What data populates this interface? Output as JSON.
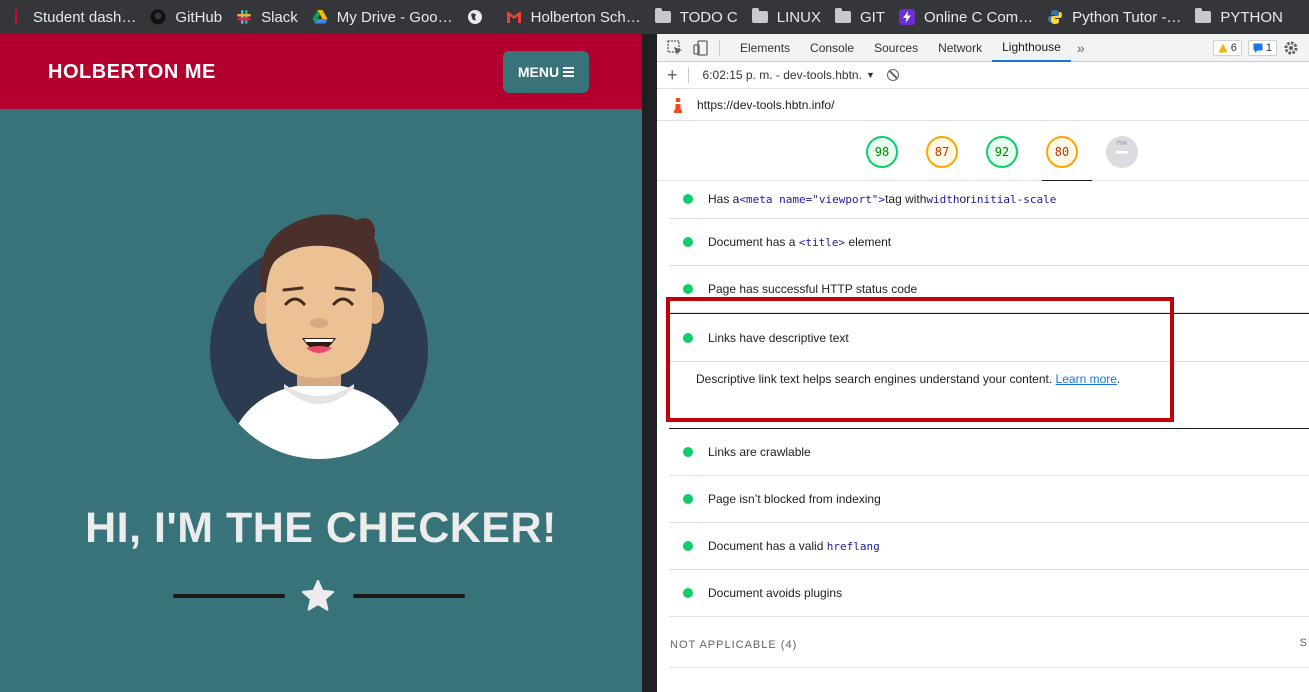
{
  "bookmarks": [
    {
      "label": "Student dash…",
      "icon": "holberton-icon"
    },
    {
      "label": "GitHub",
      "icon": "github-icon"
    },
    {
      "label": "Slack",
      "icon": "slack-icon"
    },
    {
      "label": "My Drive - Goo…",
      "icon": "drive-icon"
    },
    {
      "label": "",
      "icon": "globe-icon"
    },
    {
      "label": "Holberton Sch…",
      "icon": "gmail-icon"
    },
    {
      "label": "TODO C",
      "icon": "folder-icon"
    },
    {
      "label": "LINUX",
      "icon": "folder-icon"
    },
    {
      "label": "GIT",
      "icon": "folder-icon"
    },
    {
      "label": "Online C Com…",
      "icon": "bolt-icon"
    },
    {
      "label": "Python Tutor -…",
      "icon": "python-icon"
    },
    {
      "label": "PYTHON",
      "icon": "folder-icon"
    }
  ],
  "site": {
    "brand": "HOLBERTON ME",
    "menu_label": "MENU",
    "hero_title": "HI, I'M THE CHECKER!",
    "colors": {
      "header": "#b2002f",
      "body": "#377378"
    }
  },
  "devtools": {
    "tabs": [
      "Elements",
      "Console",
      "Sources",
      "Network",
      "Lighthouse"
    ],
    "active_tab": "Lighthouse",
    "warnings_count": "6",
    "messages_count": "1",
    "report_selector": "6:02:15 p. m. - dev-tools.hbtn.",
    "url": "https://dev-tools.hbtn.info/",
    "scores": [
      {
        "value": "98",
        "color": "#0cce6b",
        "text_color": "#008800"
      },
      {
        "value": "87",
        "color": "#ffa400",
        "text_color": "#c33300"
      },
      {
        "value": "92",
        "color": "#0cce6b",
        "text_color": "#008800"
      },
      {
        "value": "80",
        "color": "#ffa400",
        "text_color": "#c33300"
      },
      {
        "value": "PWA",
        "color": "#dadce0",
        "text_color": "#9aa0a6"
      }
    ],
    "audits": {
      "partial": {
        "pre": "Has a ",
        "code1": "<meta name=\"viewport\">",
        "mid": " tag with ",
        "code2": "width",
        "post": " or ",
        "code3": "initial-scale"
      },
      "title_el": {
        "pre": "Document has a ",
        "code": "<title>",
        "post": " element"
      },
      "http_status": "Page has successful HTTP status code",
      "links_desc": "Links have descriptive text",
      "links_desc_detail": "Descriptive link text helps search engines understand your content.",
      "learn_more": "Learn more",
      "crawlable": "Links are crawlable",
      "not_blocked": "Page isn’t blocked from indexing",
      "hreflang": {
        "pre": "Document has a valid ",
        "code": "hreflang"
      },
      "plugins": "Document avoids plugins"
    },
    "not_applicable": "NOT APPLICABLE",
    "not_applicable_count": "(4)",
    "not_applicable_right": "S"
  }
}
